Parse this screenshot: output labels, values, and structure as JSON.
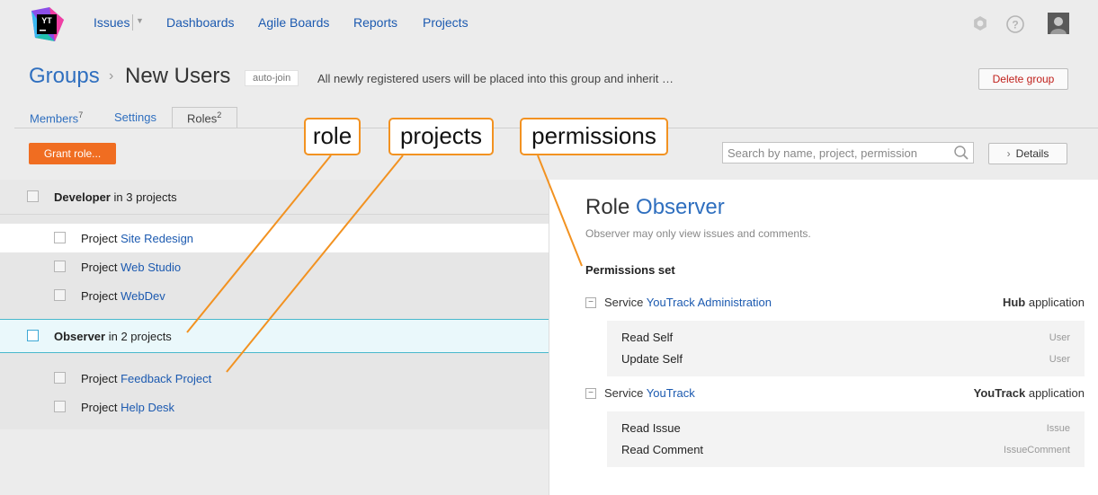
{
  "nav": {
    "logo_text": "YT",
    "items": [
      "Issues",
      "Dashboards",
      "Agile Boards",
      "Reports",
      "Projects"
    ]
  },
  "header": {
    "breadcrumb_root": "Groups",
    "title": "New Users",
    "badge": "auto-join",
    "description": "All newly registered users will be placed into this group and inherit …",
    "delete_label": "Delete group"
  },
  "tabs": {
    "members_label": "Members",
    "members_count": "7",
    "settings_label": "Settings",
    "roles_label": "Roles",
    "roles_count": "2"
  },
  "toolbar": {
    "grant_label": "Grant role...",
    "search_placeholder": "Search by name, project, permission",
    "details_label": "Details"
  },
  "roles": [
    {
      "name": "Developer",
      "suffix": "in 3 projects",
      "projects": [
        {
          "prefix": "Project",
          "name": "Site Redesign"
        },
        {
          "prefix": "Project",
          "name": "Web Studio"
        },
        {
          "prefix": "Project",
          "name": "WebDev"
        }
      ]
    },
    {
      "name": "Observer",
      "suffix": "in 2 projects",
      "projects": [
        {
          "prefix": "Project",
          "name": "Feedback Project"
        },
        {
          "prefix": "Project",
          "name": "Help Desk"
        }
      ]
    }
  ],
  "details": {
    "title_prefix": "Role",
    "role_name": "Observer",
    "description": "Observer may only view issues and comments.",
    "perm_heading": "Permissions set",
    "services": [
      {
        "prefix": "Service",
        "name": "YouTrack Administration",
        "app_name": "Hub",
        "app_suffix": "application",
        "permissions": [
          {
            "name": "Read Self",
            "scope": "User"
          },
          {
            "name": "Update Self",
            "scope": "User"
          }
        ]
      },
      {
        "prefix": "Service",
        "name": "YouTrack",
        "app_name": "YouTrack",
        "app_suffix": "application",
        "permissions": [
          {
            "name": "Read Issue",
            "scope": "Issue"
          },
          {
            "name": "Read Comment",
            "scope": "IssueComment"
          }
        ]
      }
    ]
  },
  "annotations": {
    "role": "role",
    "projects": "projects",
    "permissions": "permissions"
  },
  "colors": {
    "accent": "#f06d21",
    "link": "#1c5ab0",
    "callout_border": "#f29221",
    "danger": "#c0201b"
  }
}
